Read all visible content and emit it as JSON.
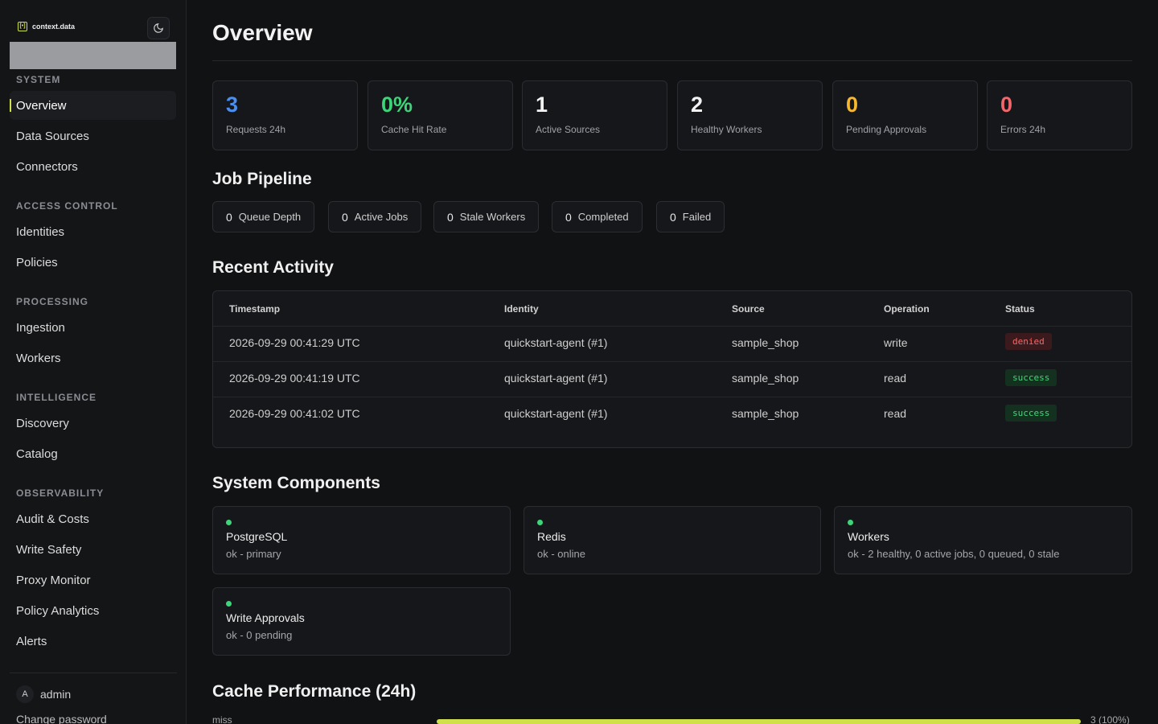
{
  "brand": {
    "name": "context.data",
    "mark": "[•]"
  },
  "sidebar": {
    "sections": [
      {
        "title": "SYSTEM",
        "items": [
          "Overview",
          "Data Sources",
          "Connectors"
        ]
      },
      {
        "title": "ACCESS CONTROL",
        "items": [
          "Identities",
          "Policies"
        ]
      },
      {
        "title": "PROCESSING",
        "items": [
          "Ingestion",
          "Workers"
        ]
      },
      {
        "title": "INTELLIGENCE",
        "items": [
          "Discovery",
          "Catalog"
        ]
      },
      {
        "title": "OBSERVABILITY",
        "items": [
          "Audit & Costs",
          "Write Safety",
          "Proxy Monitor",
          "Policy Analytics",
          "Alerts"
        ]
      }
    ],
    "active": "Overview",
    "user": {
      "initial": "A",
      "name": "admin",
      "change_password": "Change password"
    }
  },
  "page": {
    "title": "Overview"
  },
  "stats": [
    {
      "value": "3",
      "label": "Requests 24h",
      "color": "#4a8ff0"
    },
    {
      "value": "0%",
      "label": "Cache Hit Rate",
      "color": "#3ed47a"
    },
    {
      "value": "1",
      "label": "Active Sources",
      "color": "#f2f2f2"
    },
    {
      "value": "2",
      "label": "Healthy Workers",
      "color": "#f2f2f2"
    },
    {
      "value": "0",
      "label": "Pending Approvals",
      "color": "#f5b82e"
    },
    {
      "value": "0",
      "label": "Errors 24h",
      "color": "#f2676b"
    }
  ],
  "pipeline": {
    "title": "Job Pipeline",
    "items": [
      {
        "value": "0",
        "label": "Queue Depth"
      },
      {
        "value": "0",
        "label": "Active Jobs"
      },
      {
        "value": "0",
        "label": "Stale Workers"
      },
      {
        "value": "0",
        "label": "Completed"
      },
      {
        "value": "0",
        "label": "Failed"
      }
    ]
  },
  "activity": {
    "title": "Recent Activity",
    "columns": [
      "Timestamp",
      "Identity",
      "Source",
      "Operation",
      "Status"
    ],
    "rows": [
      {
        "timestamp": "2026-09-29 00:41:29 UTC",
        "identity": "quickstart-agent (#1)",
        "source": "sample_shop",
        "operation": "write",
        "status": "denied"
      },
      {
        "timestamp": "2026-09-29 00:41:19 UTC",
        "identity": "quickstart-agent (#1)",
        "source": "sample_shop",
        "operation": "read",
        "status": "success"
      },
      {
        "timestamp": "2026-09-29 00:41:02 UTC",
        "identity": "quickstart-agent (#1)",
        "source": "sample_shop",
        "operation": "read",
        "status": "success"
      }
    ]
  },
  "components": {
    "title": "System Components",
    "items": [
      {
        "name": "PostgreSQL",
        "status": "ok - primary"
      },
      {
        "name": "Redis",
        "status": "ok - online"
      },
      {
        "name": "Workers",
        "status": "ok - 2 healthy, 0 active jobs, 0 queued, 0 stale"
      },
      {
        "name": "Write Approvals",
        "status": "ok - 0 pending"
      }
    ]
  },
  "cache": {
    "title": "Cache Performance (24h)",
    "rows": [
      {
        "label": "miss",
        "value": "3 (100%)",
        "fraction": 1.0
      }
    ]
  },
  "colors": {
    "accent": "#cfe04a",
    "ok": "#3ed47a"
  }
}
